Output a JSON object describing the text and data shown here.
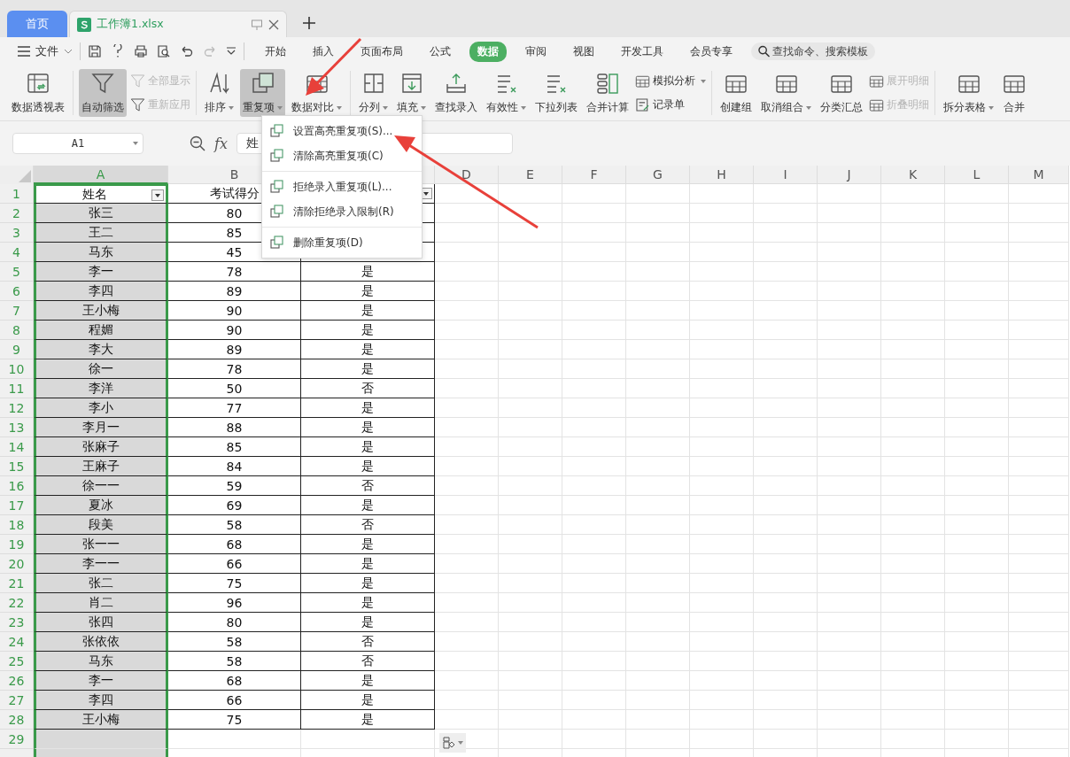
{
  "tabs": [
    {
      "label": "首页",
      "kind": "home",
      "selected": false
    },
    {
      "label": "工作簿1.xlsx",
      "kind": "sheet",
      "selected": true
    }
  ],
  "menubar": {
    "file": "文件",
    "tabs": [
      {
        "label": "开始",
        "selected": false
      },
      {
        "label": "插入",
        "selected": false
      },
      {
        "label": "页面布局",
        "selected": false
      },
      {
        "label": "公式",
        "selected": false
      },
      {
        "label": "数据",
        "selected": true
      },
      {
        "label": "审阅",
        "selected": false
      },
      {
        "label": "视图",
        "selected": false
      },
      {
        "label": "开发工具",
        "selected": false
      },
      {
        "label": "会员专享",
        "selected": false
      }
    ],
    "search": {
      "placeholder": "查找命令、搜索模板"
    }
  },
  "ribbon": [
    {
      "items": [
        {
          "kind": "large",
          "label": "数据透视表",
          "selected": false,
          "disabled": false,
          "dropdown": false
        }
      ]
    },
    {
      "items": [
        {
          "kind": "large",
          "label": "自动筛选",
          "selected": true,
          "disabled": false,
          "dropdown": false
        },
        {
          "kind": "stack",
          "items": [
            {
              "label": "全部显示",
              "disabled": true,
              "dropdown": false
            },
            {
              "label": "重新应用",
              "disabled": true,
              "dropdown": false
            }
          ]
        }
      ]
    },
    {
      "items": [
        {
          "kind": "large",
          "label": "排序",
          "selected": false,
          "disabled": false,
          "dropdown": true
        }
      ]
    },
    {
      "items": [
        {
          "kind": "large",
          "label": "重复项",
          "selected": true,
          "disabled": false,
          "dropdown": true
        },
        {
          "kind": "large",
          "label": "数据对比",
          "selected": false,
          "disabled": false,
          "dropdown": true
        }
      ]
    },
    {
      "items": [
        {
          "kind": "large",
          "label": "分列",
          "selected": false,
          "disabled": false,
          "dropdown": true
        },
        {
          "kind": "large",
          "label": "填充",
          "selected": false,
          "disabled": false,
          "dropdown": true
        },
        {
          "kind": "large",
          "label": "查找录入",
          "selected": false,
          "disabled": false,
          "dropdown": false
        },
        {
          "kind": "large",
          "label": "有效性",
          "selected": false,
          "disabled": false,
          "dropdown": true
        },
        {
          "kind": "large",
          "label": "下拉列表",
          "selected": false,
          "disabled": false,
          "dropdown": false
        },
        {
          "kind": "large",
          "label": "合并计算",
          "selected": false,
          "disabled": false,
          "dropdown": false
        },
        {
          "kind": "stack",
          "items": [
            {
              "label": "模拟分析",
              "disabled": false,
              "dropdown": true
            },
            {
              "label": "记录单",
              "disabled": false,
              "dropdown": false
            }
          ]
        }
      ]
    },
    {
      "items": [
        {
          "kind": "large",
          "label": "创建组",
          "selected": false,
          "disabled": false,
          "dropdown": false
        },
        {
          "kind": "large",
          "label": "取消组合",
          "selected": false,
          "disabled": false,
          "dropdown": true
        },
        {
          "kind": "large",
          "label": "分类汇总",
          "selected": false,
          "disabled": false,
          "dropdown": false
        },
        {
          "kind": "stack",
          "items": [
            {
              "label": "展开明细",
              "disabled": true,
              "dropdown": false
            },
            {
              "label": "折叠明细",
              "disabled": true,
              "dropdown": false
            }
          ]
        }
      ]
    },
    {
      "items": [
        {
          "kind": "large",
          "label": "拆分表格",
          "selected": false,
          "disabled": false,
          "dropdown": true
        },
        {
          "kind": "large",
          "label": "合并",
          "selected": false,
          "disabled": false,
          "dropdown": false
        }
      ]
    }
  ],
  "formula_bar": {
    "name_box": "A1",
    "fx_label": "fx",
    "value": "姓"
  },
  "sheet": {
    "columns": [
      {
        "label": "A",
        "selected": true
      },
      {
        "label": "B",
        "selected": false
      },
      {
        "selected": false
      },
      {
        "label": "D",
        "selected": false
      },
      {
        "label": "E",
        "selected": false
      },
      {
        "label": "F",
        "selected": false
      },
      {
        "label": "G",
        "selected": false
      },
      {
        "label": "H",
        "selected": false
      },
      {
        "label": "I",
        "selected": false
      },
      {
        "label": "J",
        "selected": false
      },
      {
        "label": "K",
        "selected": false
      },
      {
        "label": "L",
        "selected": false
      },
      {
        "label": "M",
        "selected": false
      }
    ],
    "header_row": {
      "number": "1",
      "cells": [
        {
          "text": "姓名",
          "filter": true
        },
        {
          "text": "考试得分",
          "filter": false
        },
        {
          "filter": true
        }
      ]
    },
    "rows": [
      {
        "number": "2",
        "cells": [
          {
            "text": "张三"
          },
          {
            "text": "80"
          }
        ]
      },
      {
        "number": "3",
        "cells": [
          {
            "text": "王二"
          },
          {
            "text": "85"
          }
        ]
      },
      {
        "number": "4",
        "cells": [
          {
            "text": "马东"
          },
          {
            "text": "45"
          }
        ]
      },
      {
        "number": "5",
        "cells": [
          {
            "text": "李一"
          },
          {
            "text": "78"
          },
          {
            "text": "是"
          }
        ]
      },
      {
        "number": "6",
        "cells": [
          {
            "text": "李四"
          },
          {
            "text": "89"
          },
          {
            "text": "是"
          }
        ]
      },
      {
        "number": "7",
        "cells": [
          {
            "text": "王小梅"
          },
          {
            "text": "90"
          },
          {
            "text": "是"
          }
        ]
      },
      {
        "number": "8",
        "cells": [
          {
            "text": "程媚"
          },
          {
            "text": "90"
          },
          {
            "text": "是"
          }
        ]
      },
      {
        "number": "9",
        "cells": [
          {
            "text": "李大"
          },
          {
            "text": "89"
          },
          {
            "text": "是"
          }
        ]
      },
      {
        "number": "10",
        "cells": [
          {
            "text": "徐一"
          },
          {
            "text": "78"
          },
          {
            "text": "是"
          }
        ]
      },
      {
        "number": "11",
        "cells": [
          {
            "text": "李洋"
          },
          {
            "text": "50"
          },
          {
            "text": "否"
          }
        ]
      },
      {
        "number": "12",
        "cells": [
          {
            "text": "李小"
          },
          {
            "text": "77"
          },
          {
            "text": "是"
          }
        ]
      },
      {
        "number": "13",
        "cells": [
          {
            "text": "李月一"
          },
          {
            "text": "88"
          },
          {
            "text": "是"
          }
        ]
      },
      {
        "number": "14",
        "cells": [
          {
            "text": "张麻子"
          },
          {
            "text": "85"
          },
          {
            "text": "是"
          }
        ]
      },
      {
        "number": "15",
        "cells": [
          {
            "text": "王麻子"
          },
          {
            "text": "84"
          },
          {
            "text": "是"
          }
        ]
      },
      {
        "number": "16",
        "cells": [
          {
            "text": "徐一一"
          },
          {
            "text": "59"
          },
          {
            "text": "否"
          }
        ]
      },
      {
        "number": "17",
        "cells": [
          {
            "text": "夏冰"
          },
          {
            "text": "69"
          },
          {
            "text": "是"
          }
        ]
      },
      {
        "number": "18",
        "cells": [
          {
            "text": "段美"
          },
          {
            "text": "58"
          },
          {
            "text": "否"
          }
        ]
      },
      {
        "number": "19",
        "cells": [
          {
            "text": "张一一"
          },
          {
            "text": "68"
          },
          {
            "text": "是"
          }
        ]
      },
      {
        "number": "20",
        "cells": [
          {
            "text": "李一一"
          },
          {
            "text": "66"
          },
          {
            "text": "是"
          }
        ]
      },
      {
        "number": "21",
        "cells": [
          {
            "text": "张二"
          },
          {
            "text": "75"
          },
          {
            "text": "是"
          }
        ]
      },
      {
        "number": "22",
        "cells": [
          {
            "text": "肖二"
          },
          {
            "text": "96"
          },
          {
            "text": "是"
          }
        ]
      },
      {
        "number": "23",
        "cells": [
          {
            "text": "张四"
          },
          {
            "text": "80"
          },
          {
            "text": "是"
          }
        ]
      },
      {
        "number": "24",
        "cells": [
          {
            "text": "张依依"
          },
          {
            "text": "58"
          },
          {
            "text": "否"
          }
        ]
      },
      {
        "number": "25",
        "cells": [
          {
            "text": "马东"
          },
          {
            "text": "58"
          },
          {
            "text": "否"
          }
        ]
      },
      {
        "number": "26",
        "cells": [
          {
            "text": "李一"
          },
          {
            "text": "68"
          },
          {
            "text": "是"
          }
        ]
      },
      {
        "number": "27",
        "cells": [
          {
            "text": "李四"
          },
          {
            "text": "66"
          },
          {
            "text": "是"
          }
        ]
      },
      {
        "number": "28",
        "cells": [
          {
            "text": "王小梅"
          },
          {
            "text": "75"
          },
          {
            "text": "是"
          }
        ]
      },
      {
        "number": "29"
      }
    ]
  },
  "dropdown_menu": {
    "groups": [
      [
        {
          "label": "设置高亮重复项(S)..."
        },
        {
          "label": "清除高亮重复项(C)"
        }
      ],
      [
        {
          "label": "拒绝录入重复项(L)..."
        },
        {
          "label": "清除拒绝录入限制(R)"
        }
      ],
      [
        {
          "label": "删除重复项(D)"
        }
      ]
    ]
  }
}
